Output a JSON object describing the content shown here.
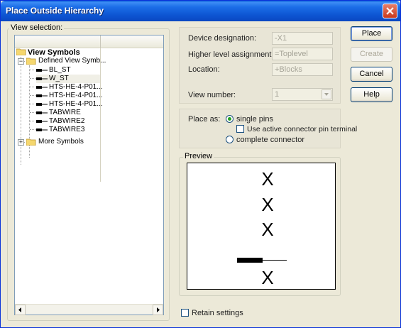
{
  "window": {
    "title": "Place Outside Hierarchy"
  },
  "view_selection": {
    "label": "View selection:",
    "tree": [
      {
        "label": "View Symbols"
      },
      {
        "label": "Defined View Symb..."
      },
      {
        "label": "BL_ST"
      },
      {
        "label": "W_ST"
      },
      {
        "label": "HTS-HE-4-P01..."
      },
      {
        "label": "HTS-HE-4-P01..."
      },
      {
        "label": "HTS-HE-4-P01..."
      },
      {
        "label": "TABWIRE"
      },
      {
        "label": "TABWIRE2"
      },
      {
        "label": "TABWIRE3"
      },
      {
        "label": "More Symbols"
      }
    ]
  },
  "fields": {
    "device_designation": {
      "label": "Device designation:",
      "value": "-X1"
    },
    "higher_level": {
      "label": "Higher level assignment:",
      "value": "=Toplevel"
    },
    "location": {
      "label": "Location:",
      "value": "+Blocks"
    },
    "view_number": {
      "label": "View number:",
      "value": "1"
    }
  },
  "place_as": {
    "label": "Place as:",
    "single_pins": "single pins",
    "use_active": "Use active connector pin terminal",
    "complete_connector": "complete connector"
  },
  "preview": {
    "label": "Preview",
    "x_glyphs": [
      "X",
      "X",
      "X",
      "X"
    ]
  },
  "retain_settings": "Retain settings",
  "buttons": {
    "place": "Place",
    "create": "Create",
    "cancel": "Cancel",
    "help": "Help"
  },
  "colors": {
    "titlebar": "#0a5fd8",
    "dialog_bg": "#ece9d8",
    "selected_radio": "#21a121"
  }
}
